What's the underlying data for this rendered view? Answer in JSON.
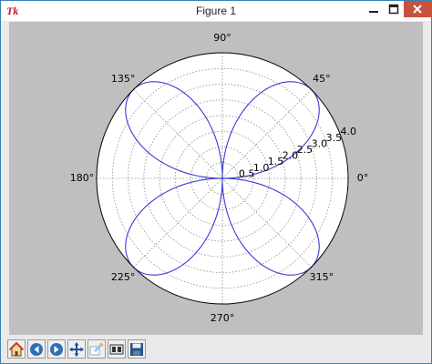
{
  "window": {
    "title": "Figure 1",
    "app_logo": "Tk"
  },
  "titlebar_buttons": [
    "minimize-icon",
    "maximize-icon",
    "close-icon"
  ],
  "toolbar": {
    "buttons": [
      "home-icon",
      "back-icon",
      "forward-icon",
      "pan-icon",
      "zoom-icon",
      "subplots-icon",
      "save-icon"
    ]
  },
  "chart_data": {
    "type": "line",
    "projection": "polar",
    "curve": "r = 4|sin 2θ| (four-petal rose)",
    "theta_deg": [
      0,
      15,
      30,
      45,
      60,
      75,
      90,
      105,
      120,
      135,
      150,
      165,
      180,
      195,
      210,
      225,
      240,
      255,
      270,
      285,
      300,
      315,
      330,
      345,
      360
    ],
    "r": [
      0,
      2.0,
      3.46,
      4.0,
      3.46,
      2.0,
      0,
      2.0,
      3.46,
      4.0,
      3.46,
      2.0,
      0,
      2.0,
      3.46,
      4.0,
      3.46,
      2.0,
      0,
      2.0,
      3.46,
      4.0,
      3.46,
      2.0,
      0
    ],
    "rlim": [
      0,
      4.0
    ],
    "angle_tick_labels": [
      "0°",
      "45°",
      "90°",
      "135°",
      "180°",
      "225°",
      "270°",
      "315°"
    ],
    "radial_tick_labels": [
      "0.5",
      "1.0",
      "1.5",
      "2.0",
      "2.5",
      "3.0",
      "3.5",
      "4.0"
    ],
    "line_color": "#3b3bd6",
    "grid": true,
    "background": "#bfbfbf"
  }
}
